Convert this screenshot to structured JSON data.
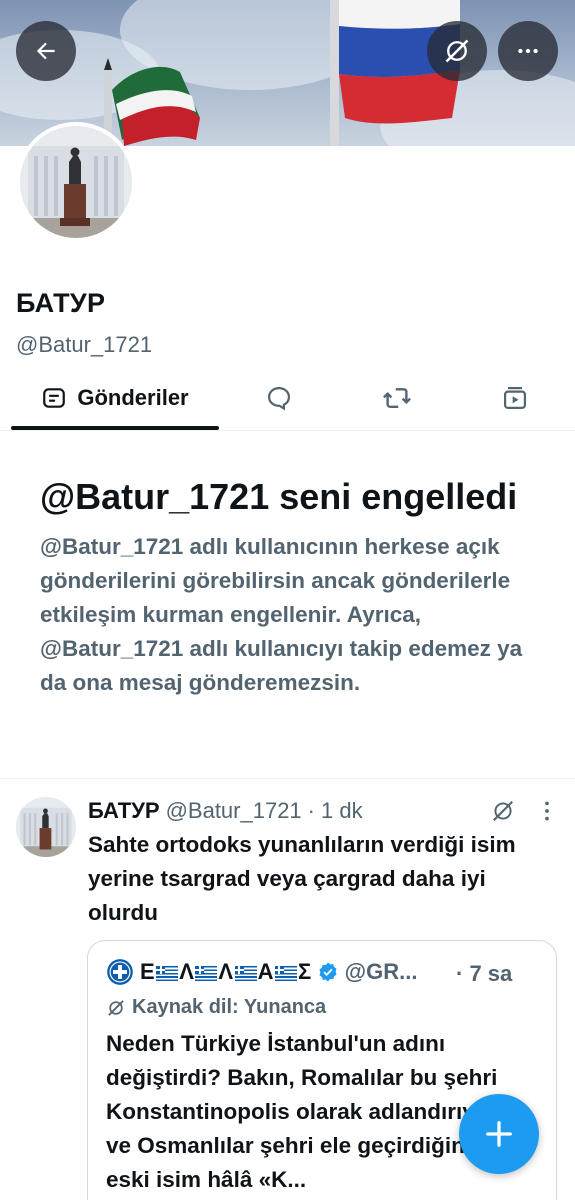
{
  "profile": {
    "name": "БАТУР",
    "handle": "@Batur_1721"
  },
  "tabs": [
    {
      "label": "Gönderiler",
      "icon": "posts-icon",
      "active": true
    },
    {
      "label": "",
      "icon": "replies-icon"
    },
    {
      "label": "",
      "icon": "reposts-icon"
    },
    {
      "label": "",
      "icon": "media-icon"
    }
  ],
  "blocked": {
    "title": "@Batur_1721 seni engelledi",
    "body": "@Batur_1721 adlı kullanıcının herkese açık gönderilerini görebilirsin ancak gönderilerle etkileşim kurman engellenir. Ayrıca, @Batur_1721 adlı kullanıcıyı takip edemez ya da ona mesaj gönderemezsin."
  },
  "tweet": {
    "name": "БАТУР",
    "handle": "@Batur_1721",
    "separator": "·",
    "time": "1 dk",
    "text": "Sahte ortodoks yunanlıların verdiği isim yerine tsargrad veya çargrad daha iyi olurdu",
    "quote": {
      "name_letters": [
        "Ε",
        "Λ",
        "Λ",
        "Α",
        "Σ"
      ],
      "handle": "@GR...",
      "time": "· 7 sa",
      "source": "Kaynak dil: Yunanca",
      "text": "Neden Türkiye İstanbul'un adını değiştirdi? Bakın, Romalılar bu şehri Konstantinopolis olarak adlandırıyordu ve Osmanlılar şehri ele geçirdiğinde, eski isim hâlâ «K..."
    }
  },
  "colors": {
    "accent": "#1d9bf0",
    "text": "#0f1419",
    "secondary": "#536471",
    "border": "#cfd9de"
  }
}
